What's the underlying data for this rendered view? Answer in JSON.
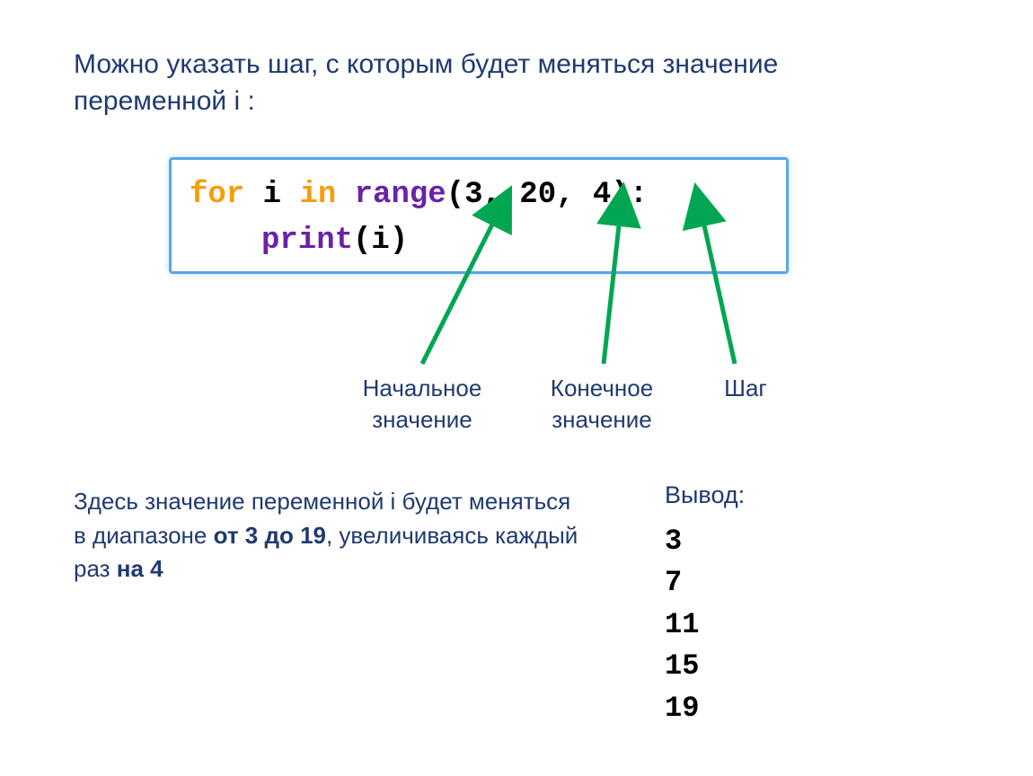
{
  "intro": "Можно указать шаг, с которым будет меняться значение переменной i :",
  "code": {
    "for": "for",
    "i": " i ",
    "in": "in",
    "space": " ",
    "range_kw": "range",
    "args": "(3, 20, 4):",
    "print_kw": "print",
    "print_arg": "(i)"
  },
  "arrow_labels": {
    "start": "Начальное значение",
    "end": "Конечное значение",
    "step": "Шаг"
  },
  "explanation": {
    "t1": "Здесь значение переменной i будет меняться в диапазоне ",
    "range_bold": "от 3 до 19",
    "t2": ", увеличиваясь каждый раз ",
    "step_bold": "на 4"
  },
  "output": {
    "label": "Вывод:",
    "lines": [
      "3",
      "7",
      "11",
      "15",
      "19"
    ]
  },
  "colors": {
    "arrow": "#00a651"
  }
}
